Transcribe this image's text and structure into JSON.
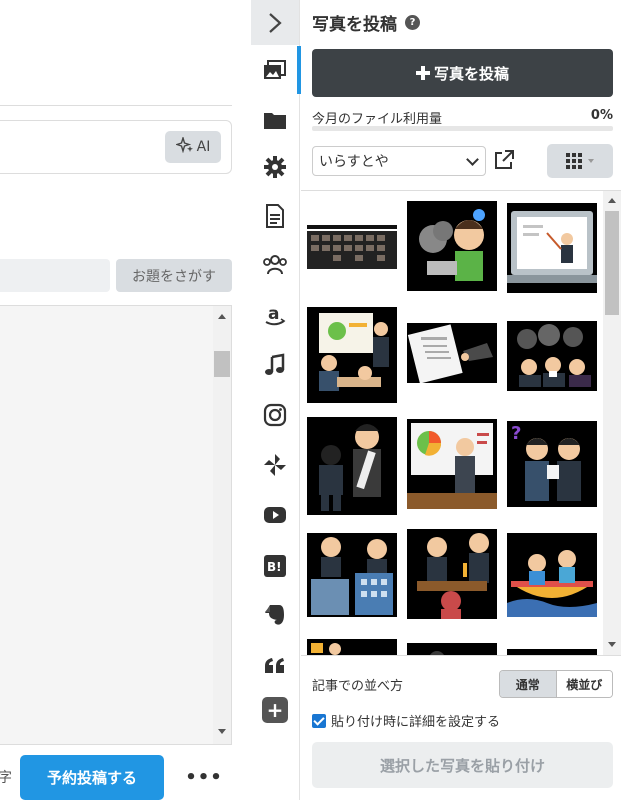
{
  "editor": {
    "ai_button_label": "AI",
    "topic_search_label": "お題をさがす",
    "char_unit": "字",
    "schedule_button": "予約投稿する",
    "more_label": "•••"
  },
  "rail": {
    "collapse_icon": "chevron-right-icon",
    "items": [
      {
        "icon": "photo-icon",
        "active": true
      },
      {
        "icon": "folder-icon"
      },
      {
        "icon": "gear-icon"
      },
      {
        "icon": "document-icon"
      },
      {
        "icon": "users-icon"
      },
      {
        "icon": "amazon-icon"
      },
      {
        "icon": "music-note-icon"
      },
      {
        "icon": "instagram-icon"
      },
      {
        "icon": "pinwheel-icon"
      },
      {
        "icon": "youtube-icon"
      },
      {
        "icon": "hatena-bookmark-icon"
      },
      {
        "icon": "evernote-icon"
      },
      {
        "icon": "quote-icon"
      }
    ],
    "add_label": "+"
  },
  "photo_panel": {
    "title": "写真を投稿",
    "post_button": "写真を投稿",
    "usage_label": "今月のファイル利用量",
    "usage_percent": "0%",
    "usage_fraction": 0,
    "source_selected": "いらすとや",
    "order_label": "記事での並べ方",
    "order_options": [
      "通常",
      "横並び"
    ],
    "order_selected": "通常",
    "detail_checkbox_label": "貼り付け時に詳細を設定する",
    "detail_checked": true,
    "paste_button": "選択した写真を貼り付け"
  },
  "colors": {
    "accent": "#2196e3",
    "dark_button": "#3d4246",
    "rail_bg": "#ffffff"
  }
}
